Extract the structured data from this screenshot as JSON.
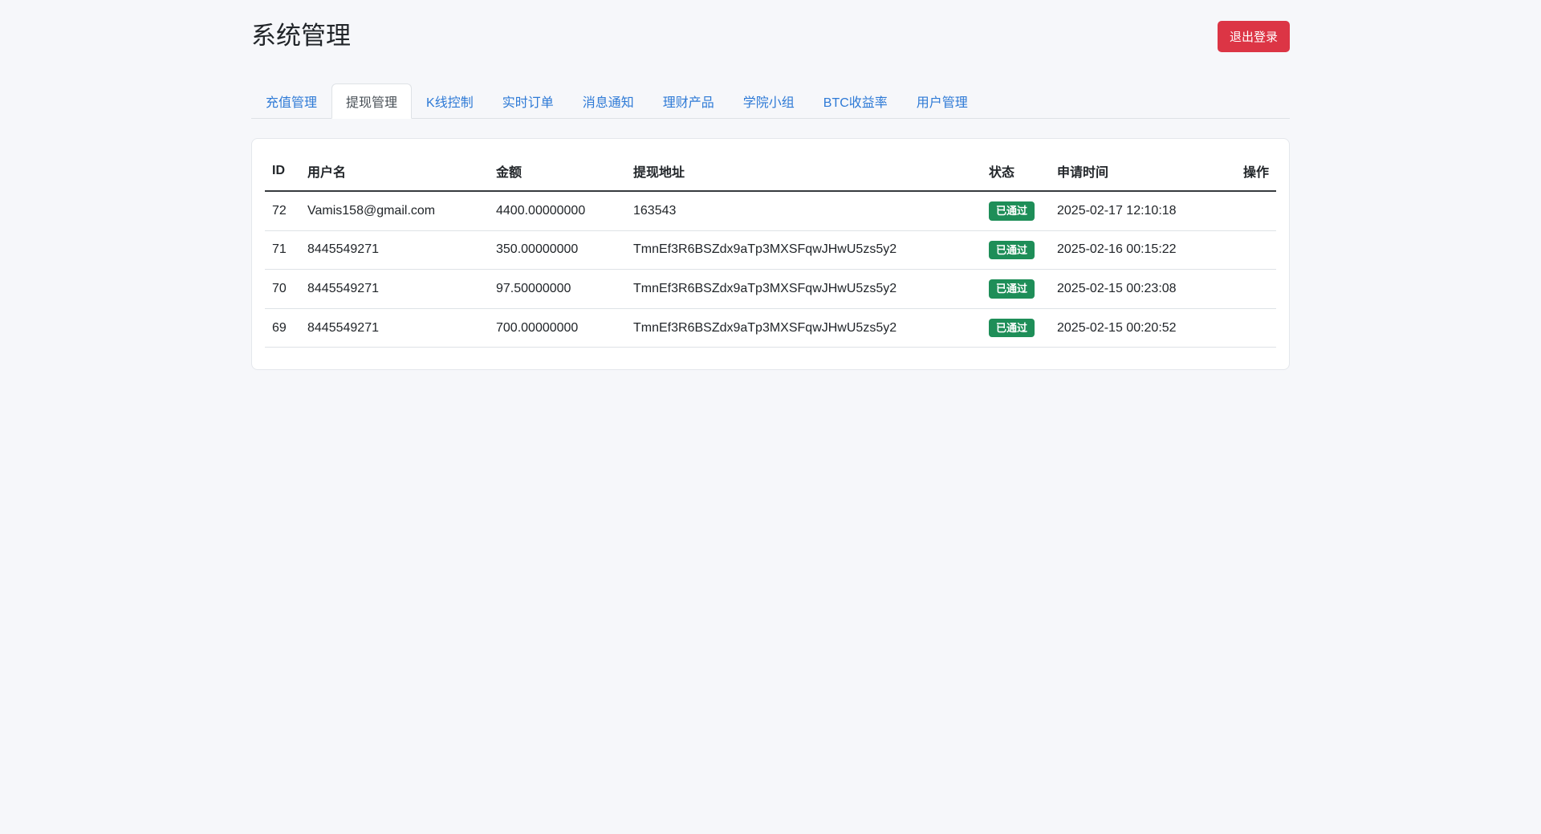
{
  "page": {
    "title": "系统管理",
    "logout_label": "退出登录"
  },
  "tabs": [
    {
      "label": "充值管理",
      "active": false
    },
    {
      "label": "提现管理",
      "active": true
    },
    {
      "label": "K线控制",
      "active": false
    },
    {
      "label": "实时订单",
      "active": false
    },
    {
      "label": "消息通知",
      "active": false
    },
    {
      "label": "理财产品",
      "active": false
    },
    {
      "label": "学院小组",
      "active": false
    },
    {
      "label": "BTC收益率",
      "active": false
    },
    {
      "label": "用户管理",
      "active": false
    }
  ],
  "table": {
    "columns": {
      "id": "ID",
      "username": "用户名",
      "amount": "金额",
      "address": "提现地址",
      "status": "状态",
      "time": "申请时间",
      "action": "操作"
    },
    "rows": [
      {
        "id": "72",
        "username": "Vamis158@gmail.com",
        "amount": "4400.00000000",
        "address": "163543",
        "status": "已通过",
        "time": "2025-02-17 12:10:18",
        "action": ""
      },
      {
        "id": "71",
        "username": "8445549271",
        "amount": "350.00000000",
        "address": "TmnEf3R6BSZdx9aTp3MXSFqwJHwU5zs5y2",
        "status": "已通过",
        "time": "2025-02-16 00:15:22",
        "action": ""
      },
      {
        "id": "70",
        "username": "8445549271",
        "amount": "97.50000000",
        "address": "TmnEf3R6BSZdx9aTp3MXSFqwJHwU5zs5y2",
        "status": "已通过",
        "time": "2025-02-15 00:23:08",
        "action": ""
      },
      {
        "id": "69",
        "username": "8445549271",
        "amount": "700.00000000",
        "address": "TmnEf3R6BSZdx9aTp3MXSFqwJHwU5zs5y2",
        "status": "已通过",
        "time": "2025-02-15 00:20:52",
        "action": ""
      }
    ]
  },
  "colors": {
    "link_blue": "#2e7ad6",
    "badge_green": "#1e8e58",
    "logout_red": "#dc3545",
    "page_bg": "#f6f7fa"
  }
}
